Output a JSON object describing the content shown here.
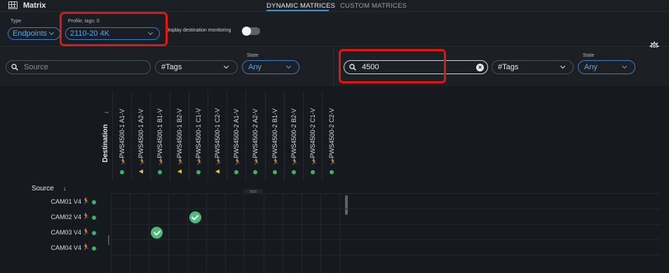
{
  "app": {
    "title": "Matrix"
  },
  "tabs": [
    {
      "label": "DYNAMIC MATRICES",
      "active": true
    },
    {
      "label": "CUSTOM MATRICES",
      "active": false
    }
  ],
  "header": {
    "type_label": "Type",
    "type_value": "Endpoints",
    "profile_label": "Profile, tags: 0",
    "profile_value": "2110-20 4K",
    "toggle_label": "Display destination monitoring",
    "toggle_on": false
  },
  "source_filter": {
    "search_placeholder": "Source",
    "tags_value": "#Tags",
    "state_label": "State",
    "state_value": "Any"
  },
  "destination_filter": {
    "search_value": "4500",
    "tags_value": "#Tags",
    "state_label": "State",
    "state_value": "Any"
  },
  "matrix": {
    "destination_label": "Destination",
    "source_label": "Source",
    "destinations": [
      {
        "name": "PWS4500-1 A1-V",
        "status": "ok"
      },
      {
        "name": "PWS4500-1 A2-V",
        "status": "warning"
      },
      {
        "name": "PWS4500-1 B1-V",
        "status": "ok"
      },
      {
        "name": "PWS4500-1 B2-V",
        "status": "warning"
      },
      {
        "name": "PWS4500-1 C1-V",
        "status": "ok"
      },
      {
        "name": "PWS4500-1 C2-V",
        "status": "warning"
      },
      {
        "name": "PWS4500-2 A1-V",
        "status": "ok"
      },
      {
        "name": "PWS4500-2 A2-V",
        "status": "ok"
      },
      {
        "name": "PWS4500-2 B1-V",
        "status": "ok"
      },
      {
        "name": "PWS4500-2 B2-V",
        "status": "ok"
      },
      {
        "name": "PWS4500-2 C1-V",
        "status": "ok"
      },
      {
        "name": "PWS4500-2 C2-V",
        "status": "ok"
      }
    ],
    "sources": [
      {
        "name": "CAM01 V4",
        "status": "ok"
      },
      {
        "name": "CAM02 V4",
        "status": "ok"
      },
      {
        "name": "CAM03 V4",
        "status": "ok"
      },
      {
        "name": "CAM04 V4",
        "status": "ok"
      }
    ],
    "connections": [
      {
        "source": "CAM02 V4",
        "destination": "PWS4500-1 C1-V"
      },
      {
        "source": "CAM03 V4",
        "destination": "PWS4500-1 B1-V"
      }
    ]
  },
  "colors": {
    "accent": "#3f8ed8",
    "ok": "#39b36b",
    "warning": "#f2c12e",
    "highlight": "#e01515"
  },
  "icons": [
    "grid-icon",
    "chevron-down-icon",
    "gear-icon",
    "search-icon",
    "clear-icon",
    "arrow-right-icon",
    "arrow-down-icon",
    "walker-icon",
    "status-dot-icon",
    "warning-triangle-icon",
    "check-icon"
  ]
}
